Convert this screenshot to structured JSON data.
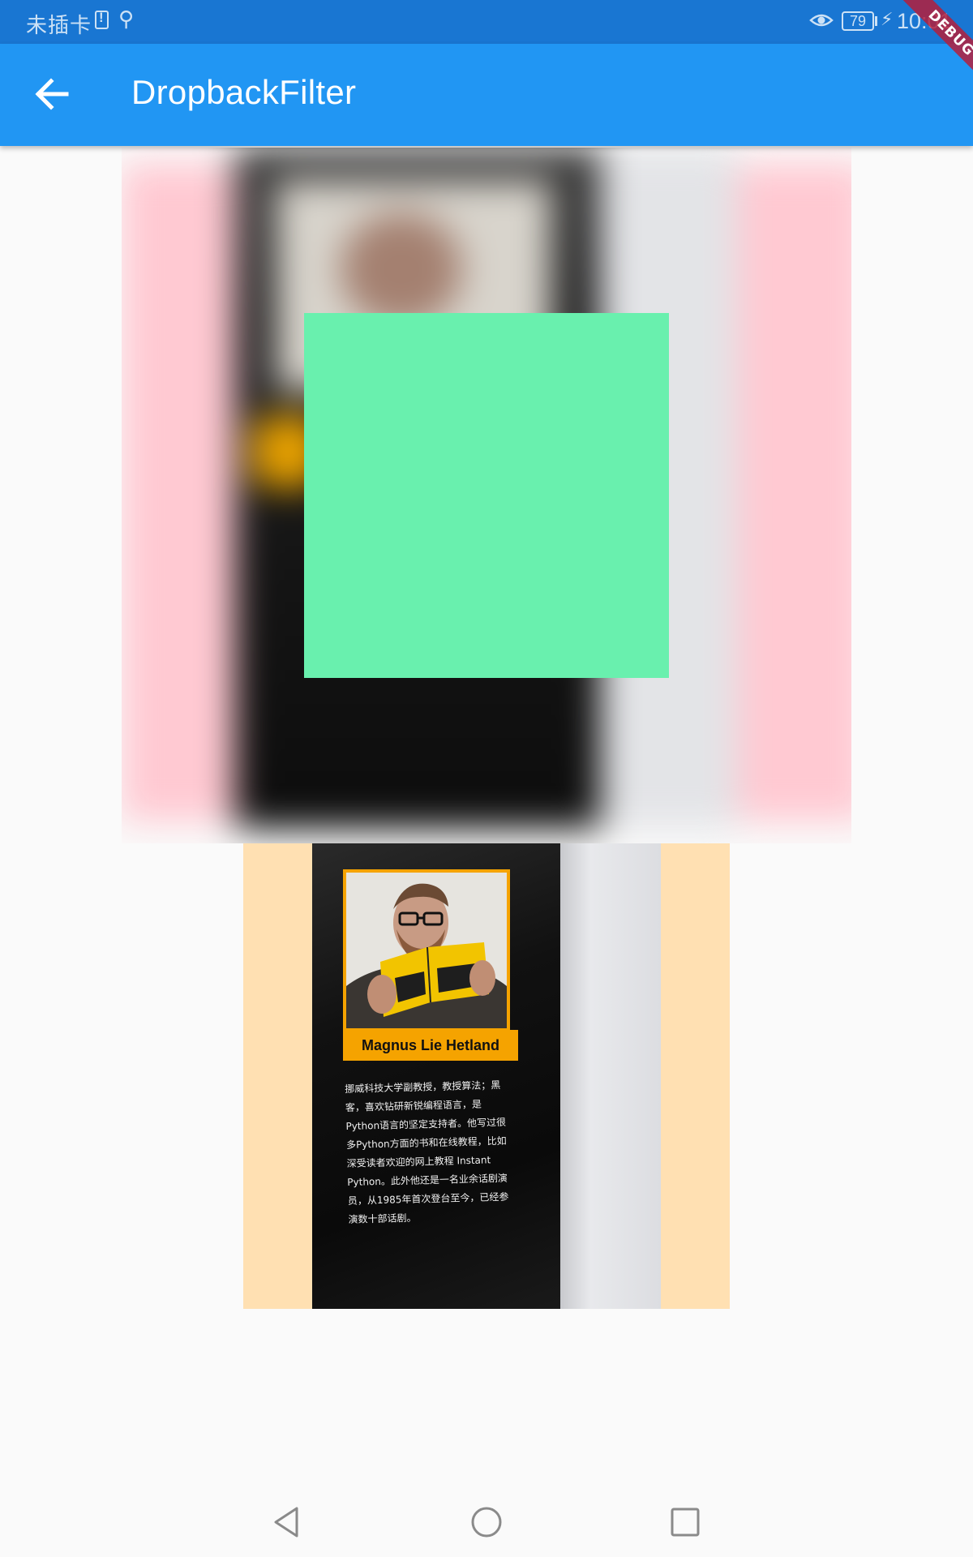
{
  "status_bar": {
    "carrier": "未插卡",
    "battery": "79",
    "time": "10:01"
  },
  "app_bar": {
    "title": "DropbackFilter"
  },
  "debug_banner": "DEBUG",
  "book": {
    "author_name": "Magnus Lie Hetland",
    "bio_lines": [
      "挪威科技大学副教授，教授算法；黑",
      "客，喜欢钻研新锐编程语言，是",
      "Python语言的坚定支持者。他写过很",
      "多Python方面的书和在线教程，比如",
      "深受读者欢迎的网上教程 Instant",
      "Python。此外他还是一名业余话剧演",
      "员，从1985年首次登台至今，已经参",
      "演数十部话剧。"
    ]
  },
  "colors": {
    "status_bar": "#1976d2",
    "app_bar": "#2196f3",
    "green_box": "#69f0ae",
    "image_background": "#ffe0b2",
    "pink_strip": "#ffc9d2"
  },
  "icons": {
    "back": "arrow-left-icon",
    "nav_back": "triangle-back-icon",
    "nav_home": "circle-home-icon",
    "nav_recents": "square-recents-icon"
  }
}
